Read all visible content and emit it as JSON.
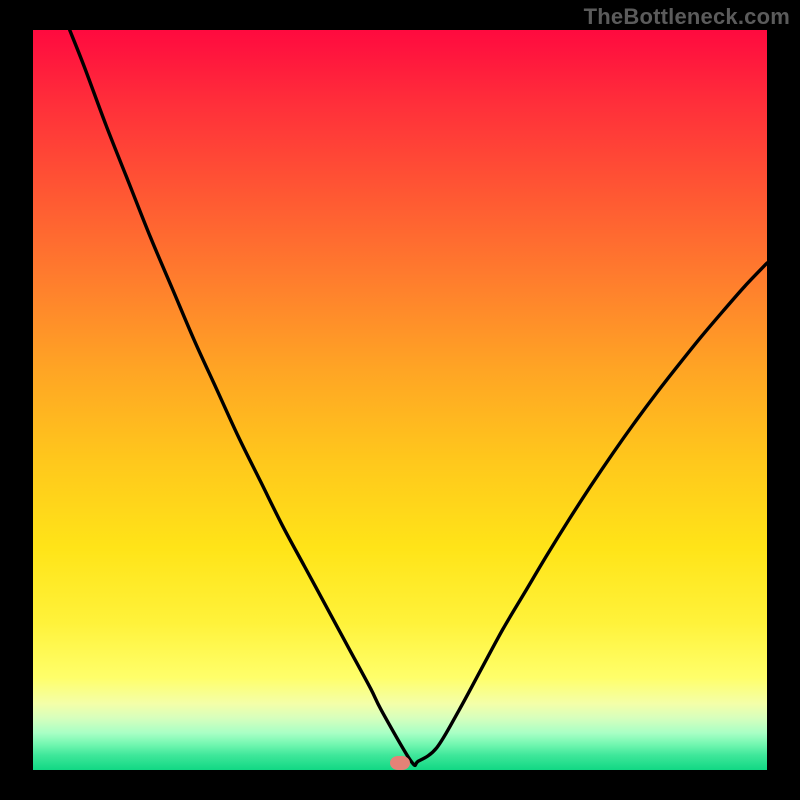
{
  "attribution": "TheBottleneck.com",
  "chart_data": {
    "type": "line",
    "title": "",
    "xlabel": "",
    "ylabel": "",
    "xlim": [
      0,
      100
    ],
    "ylim": [
      0,
      100
    ],
    "grid": false,
    "legend": false,
    "axes_visible": false,
    "background": "rainbow-vertical-gradient",
    "series": [
      {
        "name": "bottleneck-curve",
        "color": "#000000",
        "x": [
          5,
          7,
          10,
          13,
          16,
          19,
          22,
          25,
          28,
          31,
          34,
          37,
          40,
          43,
          46,
          47.5,
          51.5,
          52.5,
          55,
          58,
          61,
          64,
          67,
          70,
          73,
          76,
          79,
          82,
          85,
          88,
          91,
          94,
          97,
          100
        ],
        "values": [
          100,
          95,
          87,
          79.5,
          72,
          65,
          58,
          51.5,
          45,
          39,
          33,
          27.5,
          22,
          16.5,
          11,
          8,
          1.2,
          1.2,
          3,
          8,
          13.5,
          19,
          24,
          29,
          33.8,
          38.4,
          42.8,
          47,
          51,
          54.8,
          58.5,
          62,
          65.4,
          68.5
        ]
      }
    ],
    "annotations": [
      {
        "name": "optimum-marker",
        "shape": "pill",
        "color": "#e58277",
        "x": 50,
        "y": 1.0
      }
    ]
  }
}
